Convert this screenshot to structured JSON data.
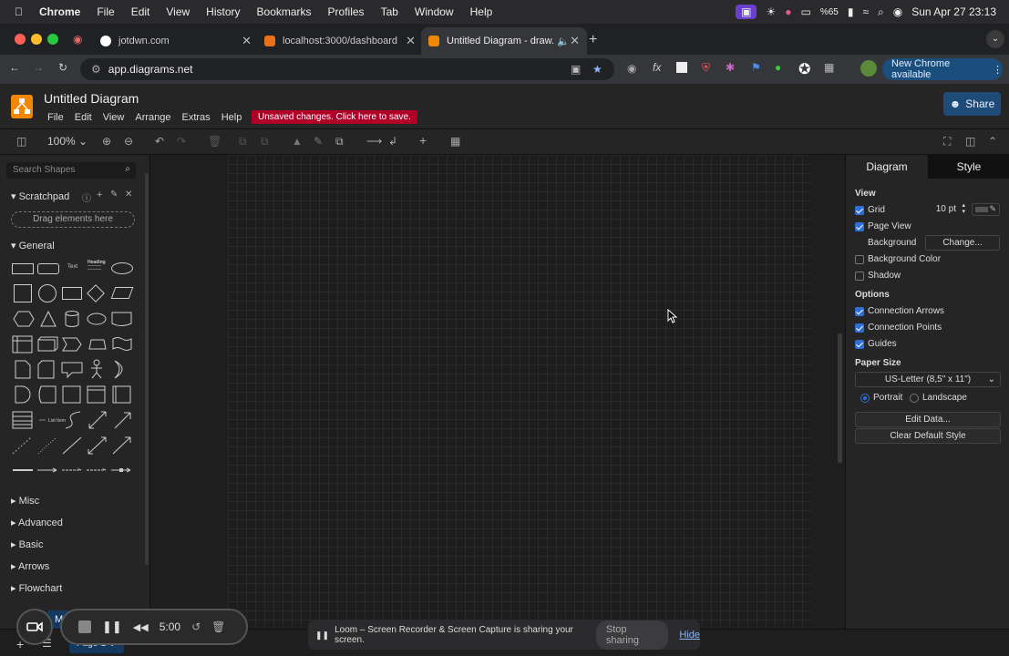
{
  "macos": {
    "menu": [
      "Chrome",
      "File",
      "Edit",
      "View",
      "History",
      "Bookmarks",
      "Profiles",
      "Tab",
      "Window",
      "Help"
    ],
    "battery": "%65",
    "clock": "Sun Apr 27  23:13"
  },
  "browser": {
    "tabs": [
      {
        "title": "jotdwn.com",
        "color": "#ffffff"
      },
      {
        "title": "localhost:3000/dashboard",
        "color": "#e8711a"
      },
      {
        "title": "Untitled Diagram - draw.io",
        "color": "#f08705"
      }
    ],
    "url": "app.diagrams.net",
    "new_chrome": "New Chrome available"
  },
  "app": {
    "title": "Untitled Diagram",
    "menus": [
      "File",
      "Edit",
      "View",
      "Arrange",
      "Extras",
      "Help"
    ],
    "unsaved": "Unsaved changes. Click here to save.",
    "share": "Share",
    "zoom": "100%"
  },
  "left": {
    "search_placeholder": "Search Shapes",
    "scratchpad": "Scratchpad",
    "drag_hint": "Drag elements here",
    "general": "General",
    "sections": [
      "Misc",
      "Advanced",
      "Basic",
      "Arrows",
      "Flowchart"
    ],
    "text_shape": "Text",
    "heading_shape": "Heading",
    "list_label": "List Item"
  },
  "right": {
    "tabs": [
      "Diagram",
      "Style"
    ],
    "view_head": "View",
    "grid": "Grid",
    "grid_size": "10 pt",
    "page_view": "Page View",
    "background": "Background",
    "change": "Change...",
    "bg_color": "Background Color",
    "shadow": "Shadow",
    "options_head": "Options",
    "conn_arrows": "Connection Arrows",
    "conn_points": "Connection Points",
    "guides": "Guides",
    "paper_head": "Paper Size",
    "paper": "US-Letter (8,5\" x 11\")",
    "portrait": "Portrait",
    "landscape": "Landscape",
    "edit_data": "Edit Data...",
    "clear_style": "Clear Default Style"
  },
  "bottom": {
    "page_tab": "Page-1",
    "more": "M"
  },
  "loom": {
    "timer": "5:00",
    "banner": "Loom – Screen Recorder & Screen Capture is sharing your screen.",
    "stop": "Stop sharing",
    "hide": "Hide"
  }
}
